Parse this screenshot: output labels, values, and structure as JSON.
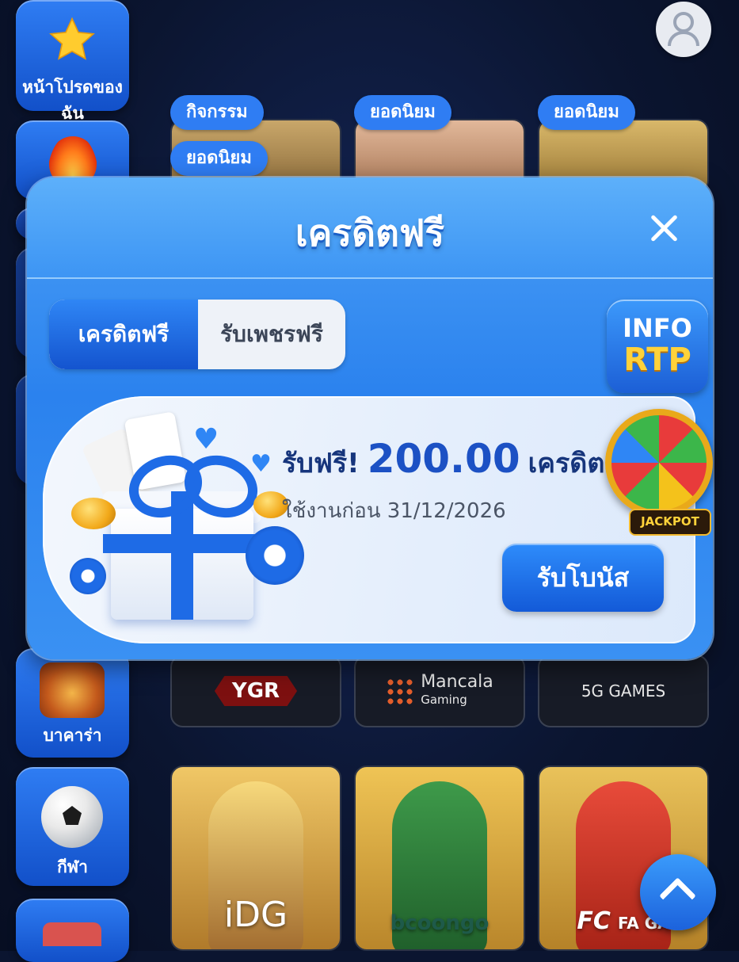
{
  "sidebar": {
    "items": [
      {
        "label": "หน้าโปรดของฉัน",
        "icon": "star-icon"
      },
      {
        "label": "",
        "icon": "fire-icon"
      },
      {
        "label": "บาคาร่า",
        "icon": "baccarat-icon"
      },
      {
        "label": "กีฬา",
        "icon": "soccer-ball-icon"
      },
      {
        "label": "",
        "icon": "book-icon"
      }
    ]
  },
  "header": {
    "avatar_icon": "user-icon"
  },
  "tags": {
    "activity": "กิจกรรม",
    "popular": "ยอดนิยม"
  },
  "providers": {
    "row1": [
      "YGR",
      "Mancala",
      "Gaming",
      "5G GAMES"
    ],
    "row2": [
      "iDG",
      "bcoongo",
      "FA GA"
    ],
    "fc_logo": "FC"
  },
  "modal": {
    "title": "เครดิตฟรี",
    "tabs": [
      {
        "label": "เครดิตฟรี",
        "active": true
      },
      {
        "label": "รับเพชรฟรี",
        "active": false
      }
    ],
    "rtp": {
      "line1": "INFO",
      "line2": "RTP"
    },
    "bonus": {
      "prefix": "รับฟรี!",
      "amount": "200.00",
      "unit": "เครดิต",
      "expiry": "ใช้งานก่อน 31/12/2026",
      "claim_label": "รับโบนัส"
    },
    "jackpot_label": "JACKPOT"
  },
  "colors": {
    "accent": "#2f7df3",
    "gold": "#ffd23a",
    "background": "#0b1530"
  }
}
